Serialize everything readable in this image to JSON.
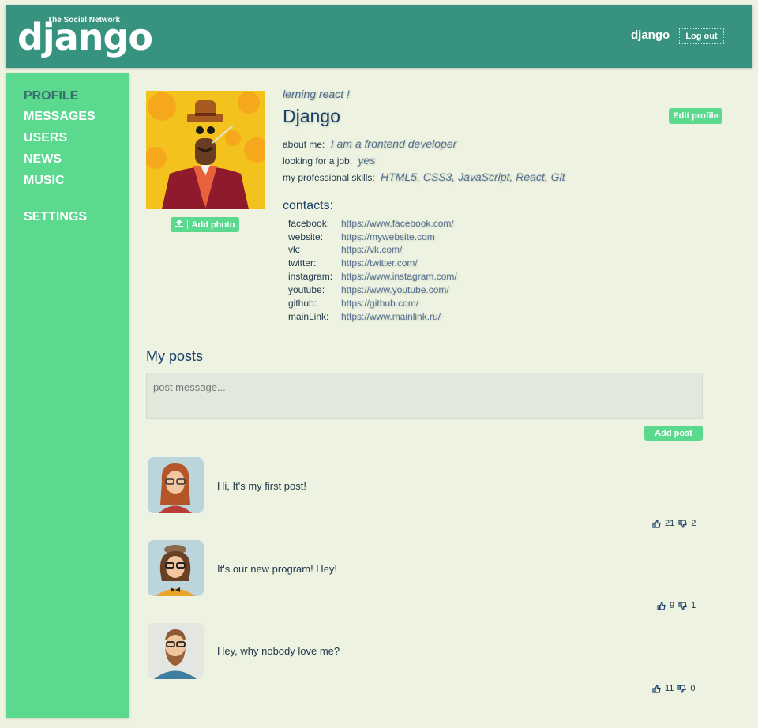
{
  "header": {
    "logo_tagline": "The Social Network",
    "logo_word": "django",
    "username": "django",
    "logout_label": "Log out"
  },
  "sidebar": {
    "items": [
      {
        "label": "Profile",
        "active": true
      },
      {
        "label": "Messages"
      },
      {
        "label": "Users"
      },
      {
        "label": "News"
      },
      {
        "label": "Music"
      },
      {
        "label": "Settings"
      }
    ]
  },
  "profile": {
    "status": "lerning react !",
    "full_name": "Django",
    "edit_label": "Edit profile",
    "add_photo_label": "Add photo",
    "about_label": "about me:",
    "about_value": "I am a frontend developer",
    "job_label": "looking for a job:",
    "job_value": "yes",
    "skills_label": "my professional skills:",
    "skills_value": "HTML5, CSS3, JavaScript, React, Git",
    "contacts_title": "contacts:",
    "contacts": [
      {
        "key": "facebook:",
        "value": "https://www.facebook.com/"
      },
      {
        "key": "website:",
        "value": "https://mywebsite.com"
      },
      {
        "key": "vk:",
        "value": "https://vk.com/"
      },
      {
        "key": "twitter:",
        "value": "https://twitter.com/"
      },
      {
        "key": "instagram:",
        "value": "https://www.instagram.com/"
      },
      {
        "key": "youtube:",
        "value": "https://www.youtube.com/"
      },
      {
        "key": "github:",
        "value": "https://github.com/"
      },
      {
        "key": "mainLink:",
        "value": "https://www.mainlink.ru/"
      }
    ]
  },
  "posts": {
    "title": "My posts",
    "placeholder": "post message...",
    "add_label": "Add post",
    "items": [
      {
        "text": "Hi, It's my first post!",
        "likes": "21",
        "dislikes": "2"
      },
      {
        "text": "It's our new program! Hey!",
        "likes": "9",
        "dislikes": "1"
      },
      {
        "text": "Hey, why nobody love me?",
        "likes": "11",
        "dislikes": "0"
      }
    ]
  },
  "colors": {
    "header": "#379380",
    "sidebar": "#5bd98f",
    "background": "#edf3e0",
    "button": "#5bd98f"
  }
}
